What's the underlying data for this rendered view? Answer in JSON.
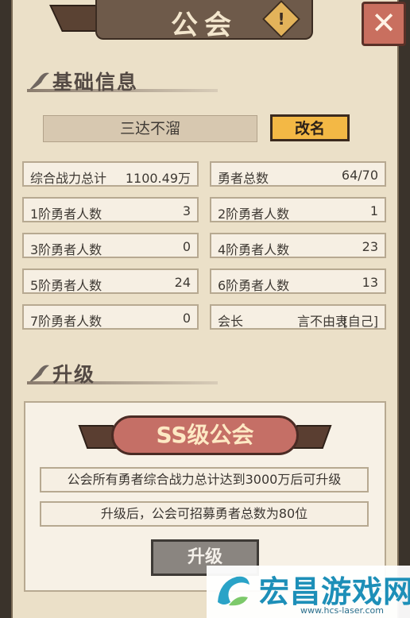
{
  "window": {
    "title": "公会",
    "info_label": "!",
    "close_label": "✕"
  },
  "basic": {
    "heading": "基础信息",
    "guild_name": "三达不溜",
    "rename_label": "改名",
    "stats": [
      {
        "label": "综合战力总计",
        "value": "1100.49万"
      },
      {
        "label": "勇者总数",
        "value": "64/70"
      },
      {
        "label": "1阶勇者人数",
        "value": "3"
      },
      {
        "label": "2阶勇者人数",
        "value": "1"
      },
      {
        "label": "3阶勇者人数",
        "value": "0"
      },
      {
        "label": "4阶勇者人数",
        "value": "23"
      },
      {
        "label": "5阶勇者人数",
        "value": "24"
      },
      {
        "label": "6阶勇者人数",
        "value": "13"
      },
      {
        "label": "7阶勇者人数",
        "value": "0"
      },
      {
        "label": "会长",
        "value": "言不由衷",
        "suffix": "[自己]"
      }
    ]
  },
  "upgrade": {
    "heading": "升级",
    "rank": "SS级公会",
    "condition": "公会所有勇者综合战力总计达到3000万后可升级",
    "benefit": "升级后，公会可招募勇者总数为80位",
    "button_label": "升级"
  },
  "watermark": {
    "title": "宏昌游戏网",
    "url": "www.hcs-laser.com"
  },
  "colors": {
    "accent": "#f3b845",
    "rank_pill": "#c56f66",
    "panel": "#ebe0c8",
    "watermark": "#1d8fb8"
  }
}
